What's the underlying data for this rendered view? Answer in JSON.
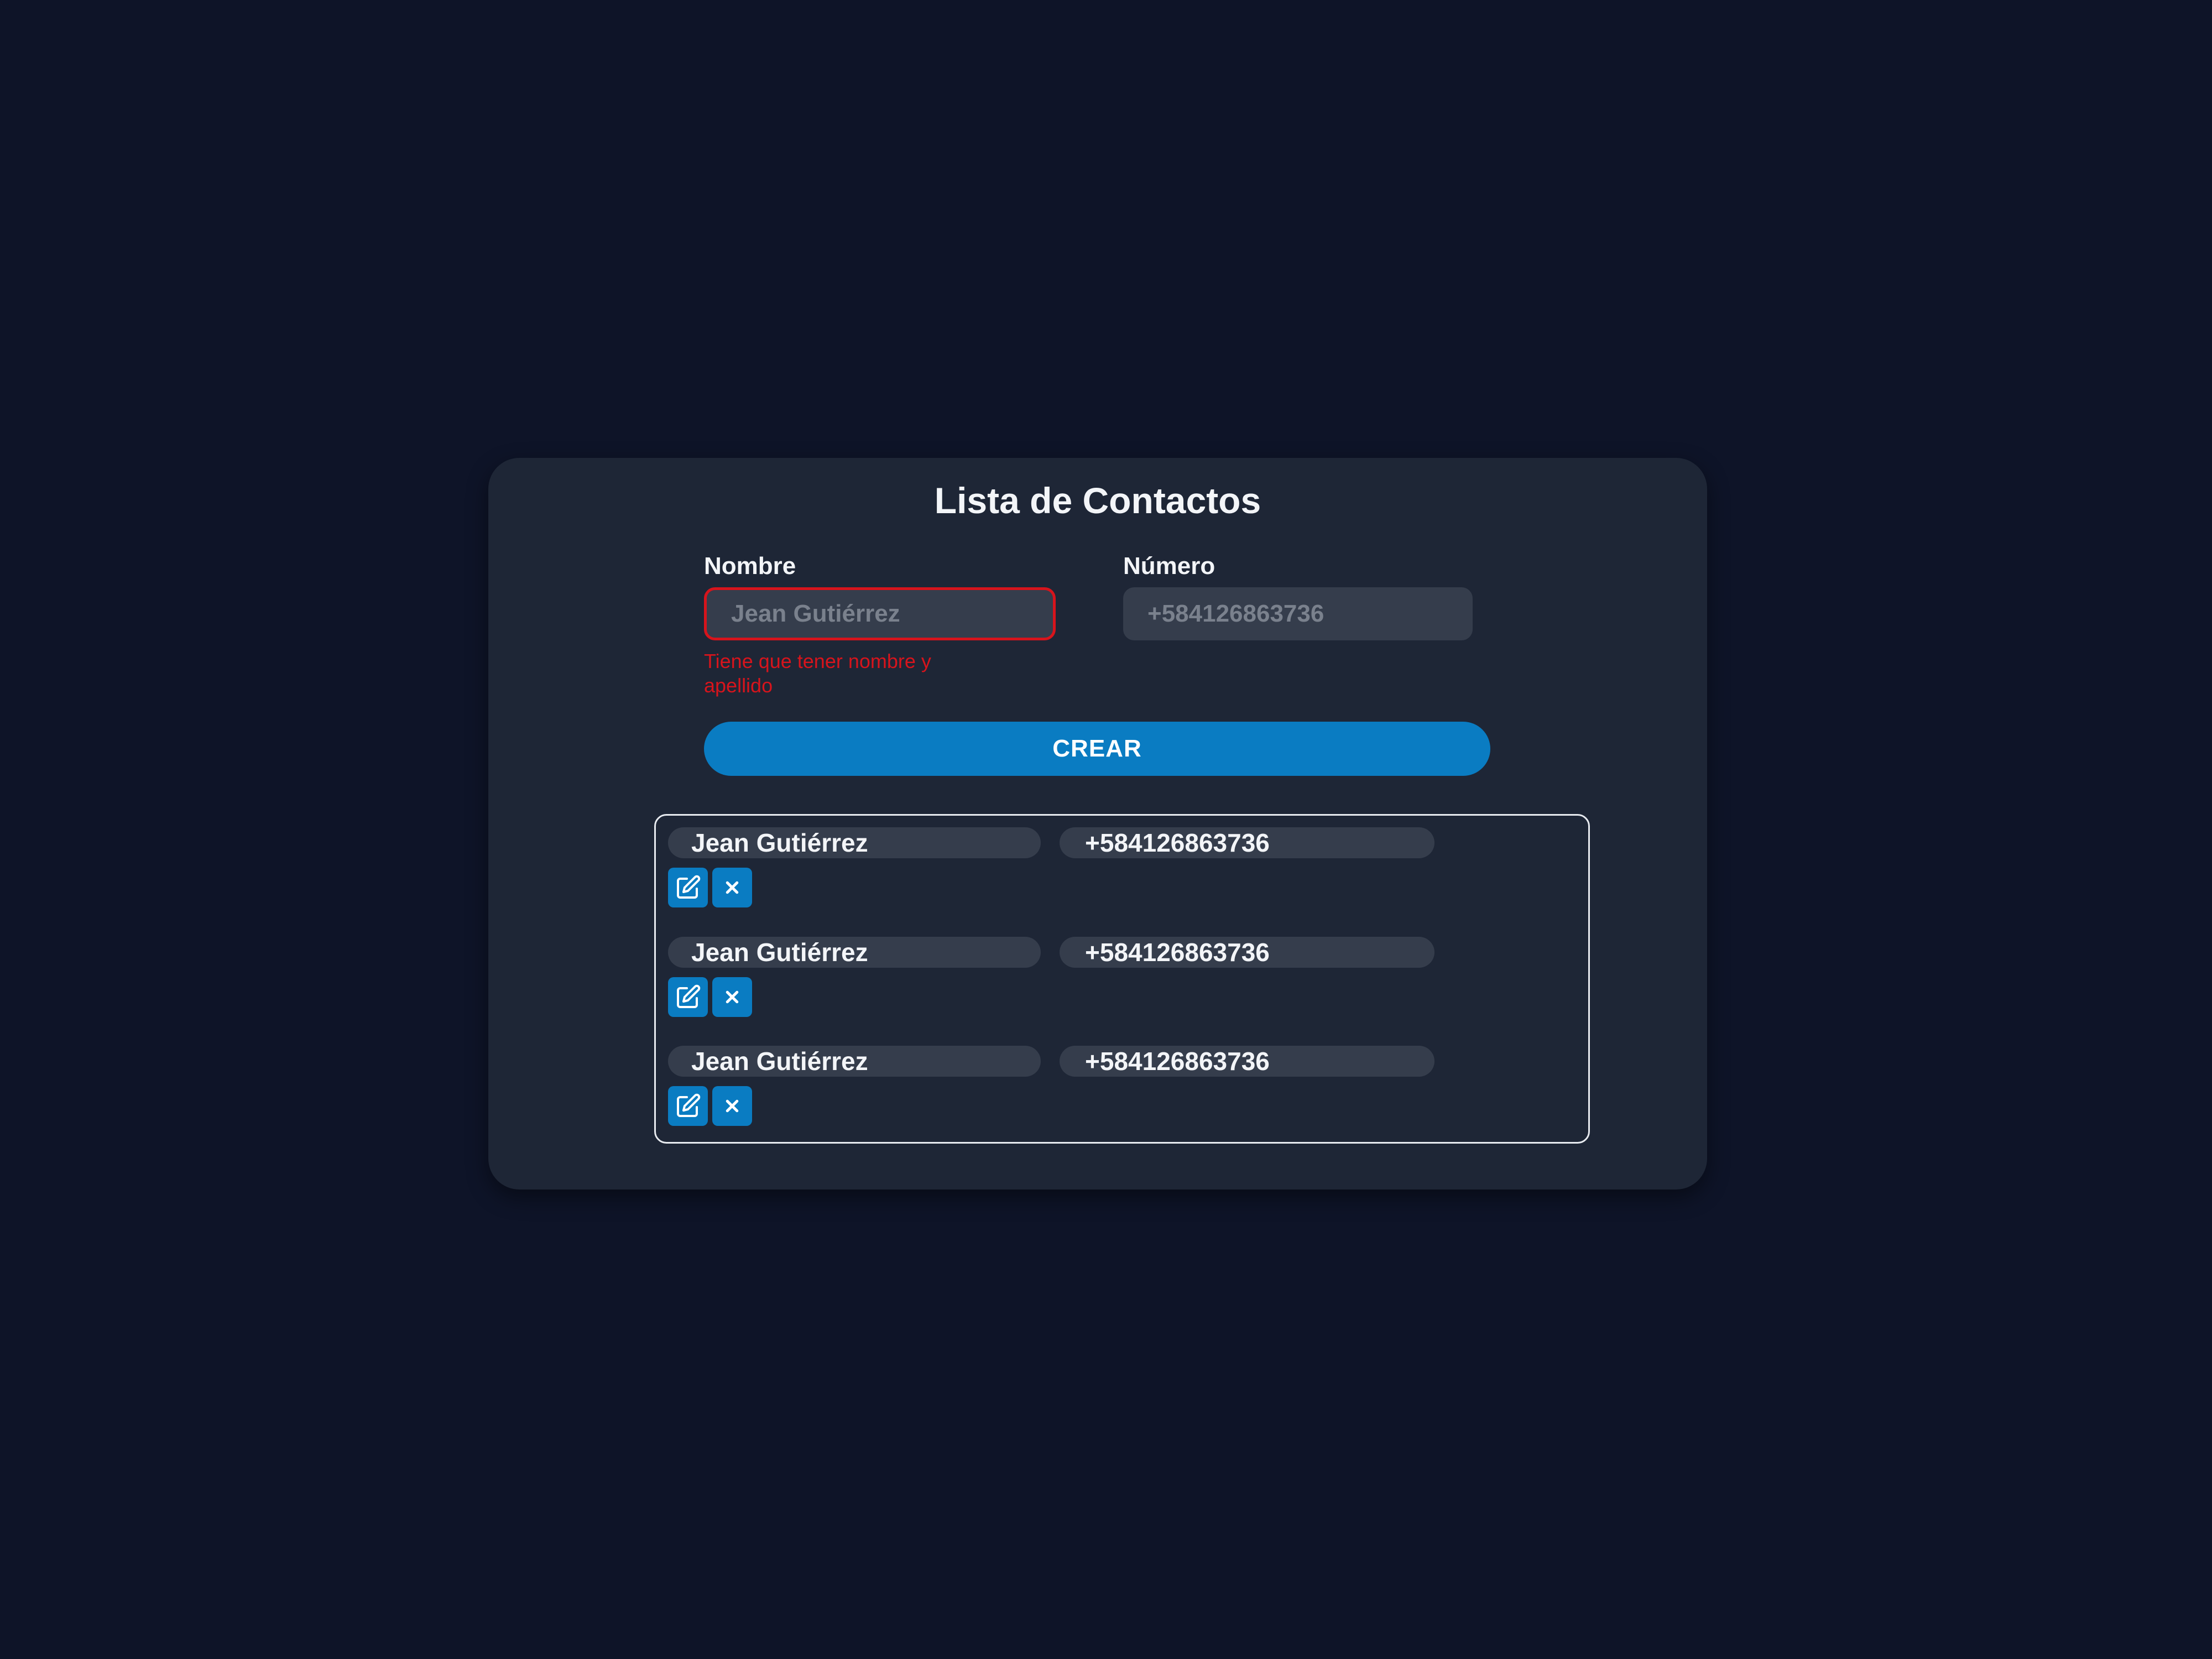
{
  "app": {
    "title": "Lista de Contactos"
  },
  "form": {
    "nombre_label": "Nombre",
    "nombre_placeholder": "Jean Gutiérrez",
    "nombre_value": "",
    "nombre_error": "Tiene que tener nombre y apellido",
    "numero_label": "Número",
    "numero_placeholder": "+584126863736",
    "numero_value": "",
    "submit_label": "CREAR"
  },
  "contacts": [
    {
      "name": "Jean Gutiérrez",
      "phone": "+584126863736"
    },
    {
      "name": "Jean Gutiérrez",
      "phone": "+584126863736"
    },
    {
      "name": "Jean Gutiérrez",
      "phone": "+584126863736"
    }
  ],
  "icons": {
    "edit": "edit-icon",
    "delete": "close-icon"
  },
  "colors": {
    "background": "#0e1428",
    "card": "#1e2636",
    "field": "#353d4c",
    "accent": "#0a7cc2",
    "error": "#d7141c",
    "text": "#f3f5f8"
  }
}
